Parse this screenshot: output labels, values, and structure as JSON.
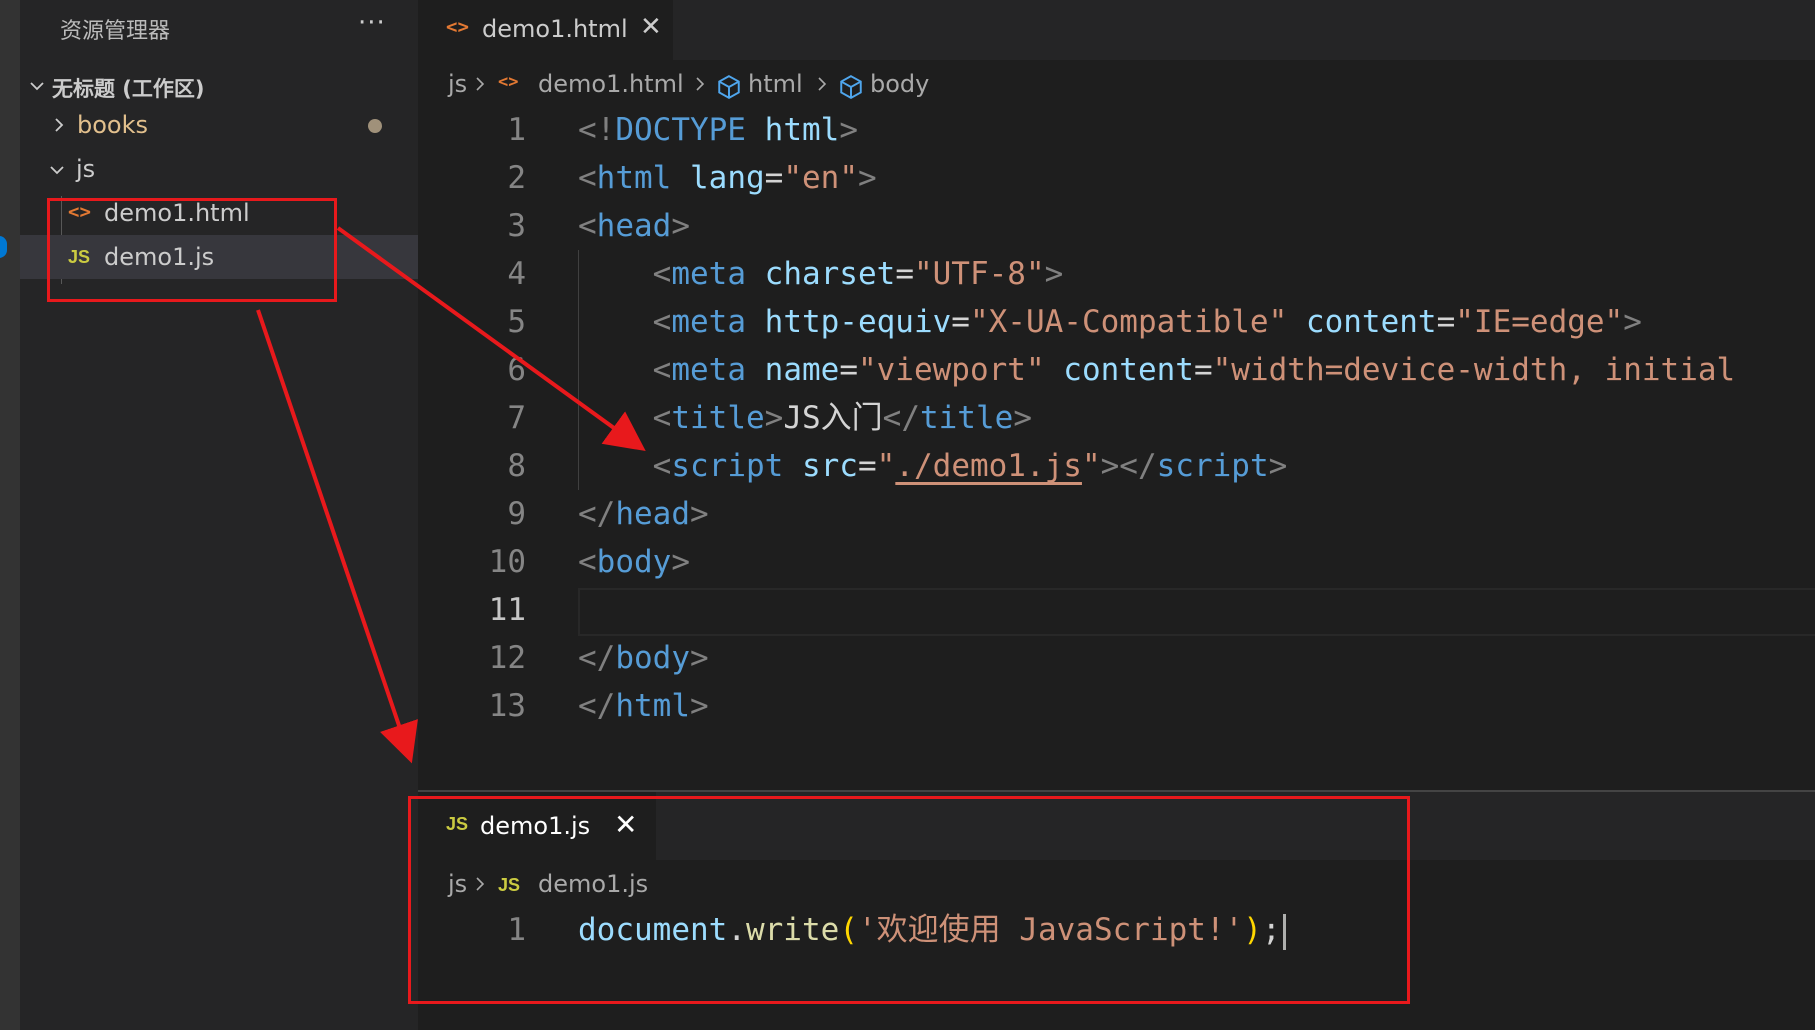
{
  "sidebar": {
    "title": "资源管理器",
    "more": "···",
    "workspace": "无标题 (工作区)",
    "items": [
      {
        "label": "books",
        "type": "folder"
      },
      {
        "label": "js",
        "type": "folder"
      },
      {
        "label": "demo1.html",
        "type": "file-html",
        "icon": "<>"
      },
      {
        "label": "demo1.js",
        "type": "file-js",
        "icon": "JS"
      }
    ]
  },
  "editor_top": {
    "tab": {
      "icon": "<>",
      "label": "demo1.html",
      "close": "✕"
    },
    "breadcrumb": [
      "js",
      "demo1.html",
      "html",
      "body"
    ],
    "lines": [
      [
        {
          "c": "k-br",
          "t": "<!"
        },
        {
          "c": "k-tag",
          "t": "DOCTYPE"
        },
        {
          "c": "k-txt",
          "t": " "
        },
        {
          "c": "k-attr",
          "t": "html"
        },
        {
          "c": "k-br",
          "t": ">"
        }
      ],
      [
        {
          "c": "k-br",
          "t": "<"
        },
        {
          "c": "k-tag",
          "t": "html"
        },
        {
          "c": "k-txt",
          "t": " "
        },
        {
          "c": "k-attr",
          "t": "lang"
        },
        {
          "c": "k-txt",
          "t": "="
        },
        {
          "c": "k-str",
          "t": "\"en\""
        },
        {
          "c": "k-br",
          "t": ">"
        }
      ],
      [
        {
          "c": "k-br",
          "t": "<"
        },
        {
          "c": "k-tag",
          "t": "head"
        },
        {
          "c": "k-br",
          "t": ">"
        }
      ],
      [
        {
          "c": "k-txt",
          "t": "    "
        },
        {
          "c": "k-br",
          "t": "<"
        },
        {
          "c": "k-tag",
          "t": "meta"
        },
        {
          "c": "k-txt",
          "t": " "
        },
        {
          "c": "k-attr",
          "t": "charset"
        },
        {
          "c": "k-txt",
          "t": "="
        },
        {
          "c": "k-str",
          "t": "\"UTF-8\""
        },
        {
          "c": "k-br",
          "t": ">"
        }
      ],
      [
        {
          "c": "k-txt",
          "t": "    "
        },
        {
          "c": "k-br",
          "t": "<"
        },
        {
          "c": "k-tag",
          "t": "meta"
        },
        {
          "c": "k-txt",
          "t": " "
        },
        {
          "c": "k-attr",
          "t": "http-equiv"
        },
        {
          "c": "k-txt",
          "t": "="
        },
        {
          "c": "k-str",
          "t": "\"X-UA-Compatible\""
        },
        {
          "c": "k-txt",
          "t": " "
        },
        {
          "c": "k-attr",
          "t": "content"
        },
        {
          "c": "k-txt",
          "t": "="
        },
        {
          "c": "k-str",
          "t": "\"IE=edge\""
        },
        {
          "c": "k-br",
          "t": ">"
        }
      ],
      [
        {
          "c": "k-txt",
          "t": "    "
        },
        {
          "c": "k-br",
          "t": "<"
        },
        {
          "c": "k-tag",
          "t": "meta"
        },
        {
          "c": "k-txt",
          "t": " "
        },
        {
          "c": "k-attr",
          "t": "name"
        },
        {
          "c": "k-txt",
          "t": "="
        },
        {
          "c": "k-str",
          "t": "\"viewport\""
        },
        {
          "c": "k-txt",
          "t": " "
        },
        {
          "c": "k-attr",
          "t": "content"
        },
        {
          "c": "k-txt",
          "t": "="
        },
        {
          "c": "k-str",
          "t": "\"width=device-width, initial"
        }
      ],
      [
        {
          "c": "k-txt",
          "t": "    "
        },
        {
          "c": "k-br",
          "t": "<"
        },
        {
          "c": "k-tag",
          "t": "title"
        },
        {
          "c": "k-br",
          "t": ">"
        },
        {
          "c": "k-txt",
          "t": "JS入门"
        },
        {
          "c": "k-br",
          "t": "</"
        },
        {
          "c": "k-tag",
          "t": "title"
        },
        {
          "c": "k-br",
          "t": ">"
        }
      ],
      [
        {
          "c": "k-txt",
          "t": "    "
        },
        {
          "c": "k-br",
          "t": "<"
        },
        {
          "c": "k-tag",
          "t": "script"
        },
        {
          "c": "k-txt",
          "t": " "
        },
        {
          "c": "k-attr",
          "t": "src"
        },
        {
          "c": "k-txt",
          "t": "="
        },
        {
          "c": "k-str",
          "t": "\""
        },
        {
          "c": "k-str link",
          "t": "./demo1.js"
        },
        {
          "c": "k-str",
          "t": "\""
        },
        {
          "c": "k-br",
          "t": "></"
        },
        {
          "c": "k-tag",
          "t": "script"
        },
        {
          "c": "k-br",
          "t": ">"
        }
      ],
      [
        {
          "c": "k-br",
          "t": "</"
        },
        {
          "c": "k-tag",
          "t": "head"
        },
        {
          "c": "k-br",
          "t": ">"
        }
      ],
      [
        {
          "c": "k-br",
          "t": "<"
        },
        {
          "c": "k-tag",
          "t": "body"
        },
        {
          "c": "k-br",
          "t": ">"
        }
      ],
      [],
      [
        {
          "c": "k-br",
          "t": "</"
        },
        {
          "c": "k-tag",
          "t": "body"
        },
        {
          "c": "k-br",
          "t": ">"
        }
      ],
      [
        {
          "c": "k-br",
          "t": "</"
        },
        {
          "c": "k-tag",
          "t": "html"
        },
        {
          "c": "k-br",
          "t": ">"
        }
      ]
    ],
    "line_numbers": [
      "1",
      "2",
      "3",
      "4",
      "5",
      "6",
      "7",
      "8",
      "9",
      "10",
      "11",
      "12",
      "13"
    ],
    "current_line": "11"
  },
  "editor_bottom": {
    "tab": {
      "icon": "JS",
      "label": "demo1.js",
      "close": "✕"
    },
    "breadcrumb": [
      "js",
      "demo1.js"
    ],
    "line_numbers": [
      "1"
    ],
    "lines": [
      [
        {
          "c": "k-attr",
          "t": "document"
        },
        {
          "c": "k-txt",
          "t": "."
        },
        {
          "c": "k-fn",
          "t": "write"
        },
        {
          "c": "k-par",
          "t": "("
        },
        {
          "c": "k-str",
          "t": "'欢迎使用 JavaScript!'"
        },
        {
          "c": "k-par",
          "t": ")"
        },
        {
          "c": "k-txt",
          "t": ";"
        }
      ]
    ]
  },
  "colors": {
    "annotation": "#e8191c",
    "accent": "#0078d4"
  }
}
